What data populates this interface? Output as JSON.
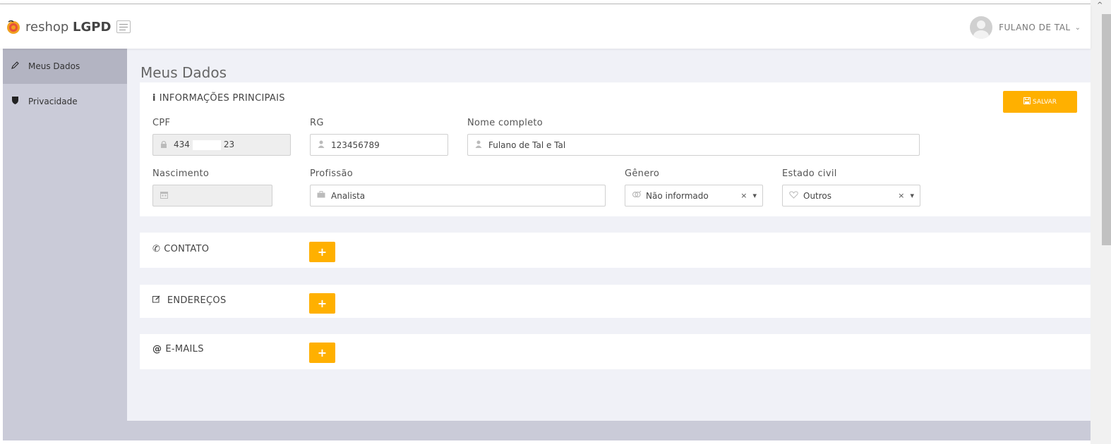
{
  "app": {
    "brand_prefix": "reshop",
    "brand_suffix": "LGPD",
    "user_name": "FULANO DE TAL",
    "user_caret": "⌄"
  },
  "sidebar": {
    "items": [
      {
        "label": "Meus Dados",
        "icon": "pencil-icon",
        "active": true
      },
      {
        "label": "Privacidade",
        "icon": "shield-icon",
        "active": false
      }
    ]
  },
  "page": {
    "title": "Meus Dados"
  },
  "main_info": {
    "title": "INFORMAÇÕES PRINCIPAIS",
    "title_icon": "i",
    "save_label": "SALVAR",
    "fields": {
      "cpf": {
        "label": "CPF",
        "value_start": "434",
        "value_end": "23"
      },
      "rg": {
        "label": "RG",
        "value": "123456789"
      },
      "nome": {
        "label": "Nome completo",
        "value": "Fulano de Tal e Tal"
      },
      "nascimento": {
        "label": "Nascimento",
        "value": ""
      },
      "profissao": {
        "label": "Profissão",
        "value": "Analista"
      },
      "genero": {
        "label": "Gênero",
        "value": "Não informado"
      },
      "estado_civil": {
        "label": "Estado civil",
        "value": "Outros"
      }
    }
  },
  "sections": {
    "contato": {
      "title": "CONTATO",
      "add_label": "+"
    },
    "enderecos": {
      "title": "ENDEREÇOS",
      "add_label": "+"
    },
    "emails": {
      "title": "E-MAILS",
      "add_label": "+"
    }
  },
  "colors": {
    "accent": "#ffb000",
    "sidebar_bg": "#cacbd8",
    "sidebar_active": "#b3b4c2",
    "content_bg": "#f0f1f7"
  }
}
